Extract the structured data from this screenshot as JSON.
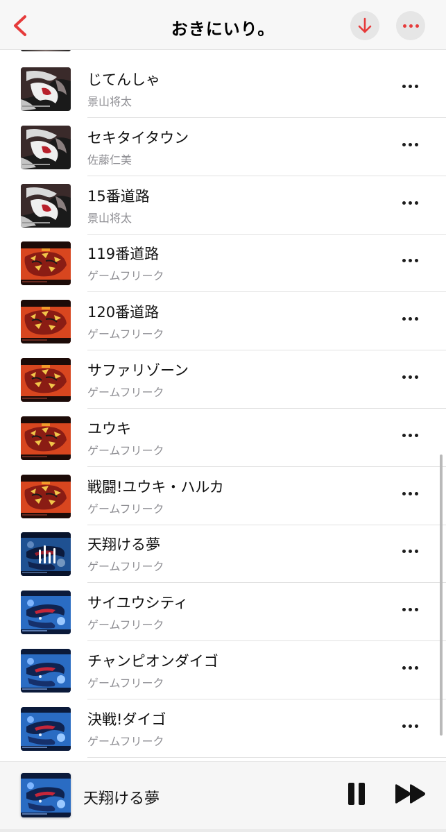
{
  "header": {
    "title": "おきにいり。",
    "back_icon": "chevron-left-icon",
    "download_icon": "arrow-down-icon",
    "more_icon": "ellipsis-icon",
    "accent_color": "#e63b3b"
  },
  "songs": [
    {
      "title": "じてんしゃ",
      "artist": "景山将太",
      "art": "white-dragon-cover"
    },
    {
      "title": "セキタイタウン",
      "artist": "佐藤仁美",
      "art": "white-dragon-cover"
    },
    {
      "title": "15番道路",
      "artist": "景山将太",
      "art": "white-dragon-cover"
    },
    {
      "title": "119番道路",
      "artist": "ゲームフリーク",
      "art": "red-groudon-cover"
    },
    {
      "title": "120番道路",
      "artist": "ゲームフリーク",
      "art": "red-groudon-cover"
    },
    {
      "title": "サファリゾーン",
      "artist": "ゲームフリーク",
      "art": "red-groudon-cover"
    },
    {
      "title": "ユウキ",
      "artist": "ゲームフリーク",
      "art": "red-groudon-cover"
    },
    {
      "title": "戦闘!ユウキ・ハルカ",
      "artist": "ゲームフリーク",
      "art": "red-groudon-cover"
    },
    {
      "title": "天翔ける夢",
      "artist": "ゲームフリーク",
      "art": "blue-kyogre-cover",
      "now_playing": true
    },
    {
      "title": "サイユウシティ",
      "artist": "ゲームフリーク",
      "art": "blue-kyogre-cover"
    },
    {
      "title": "チャンピオンダイゴ",
      "artist": "ゲームフリーク",
      "art": "blue-kyogre-cover"
    },
    {
      "title": "決戦!ダイゴ",
      "artist": "ゲームフリーク",
      "art": "blue-kyogre-cover"
    }
  ],
  "mini_player": {
    "title": "天翔ける夢",
    "art": "blue-kyogre-cover",
    "pause_icon": "pause-icon",
    "skip_icon": "skip-forward-icon"
  }
}
